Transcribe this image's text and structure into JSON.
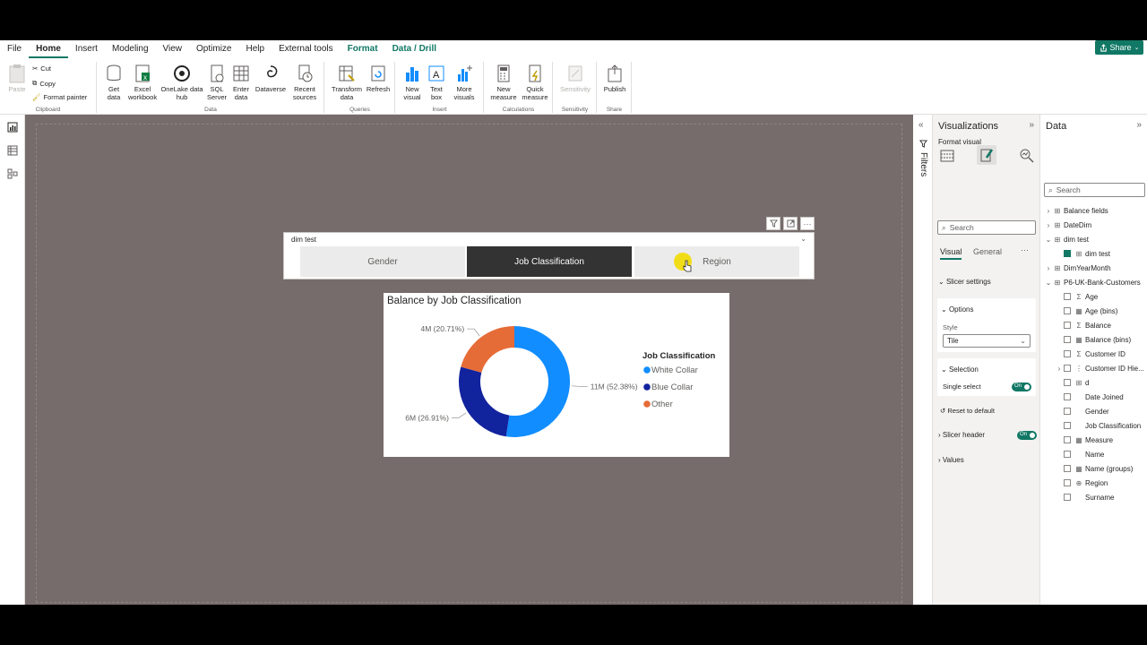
{
  "menu": [
    "File",
    "Home",
    "Insert",
    "Modeling",
    "View",
    "Optimize",
    "Help",
    "External tools",
    "Format",
    "Data / Drill"
  ],
  "menu_active": "Home",
  "share_label": "Share",
  "ribbon": {
    "clipboard": {
      "paste": "Paste",
      "cut": "Cut",
      "copy": "Copy",
      "format_painter": "Format painter",
      "label": "Clipboard"
    },
    "data": {
      "get_data": "Get\ndata",
      "excel": "Excel\nworkbook",
      "onelake": "OneLake data\nhub",
      "sql": "SQL\nServer",
      "enter": "Enter\ndata",
      "dataverse": "Dataverse",
      "recent": "Recent\nsources",
      "label": "Data"
    },
    "queries": {
      "transform": "Transform\ndata",
      "refresh": "Refresh",
      "label": "Queries"
    },
    "insert": {
      "new_visual": "New\nvisual",
      "text_box": "Text\nbox",
      "more_visuals": "More\nvisuals",
      "label": "Insert"
    },
    "calculations": {
      "new_measure": "New\nmeasure",
      "quick_measure": "Quick\nmeasure",
      "label": "Calculations"
    },
    "sensitivity": {
      "btn": "Sensitivity",
      "label": "Sensitivity"
    },
    "share": {
      "publish": "Publish",
      "label": "Share"
    }
  },
  "slicer": {
    "title": "dim test",
    "tiles": [
      "Gender",
      "Job Classification",
      "Region"
    ],
    "selected_index": 1
  },
  "chart_data": {
    "type": "pie",
    "title": "Balance by Job Classification",
    "legend_title": "Job Classification",
    "legend_position": "right",
    "categories": [
      "White Collar",
      "Blue Collar",
      "Other"
    ],
    "values": [
      52.38,
      26.91,
      20.71
    ],
    "data_labels": [
      "11M (52.38%)",
      "6M (26.91%)",
      "4M (20.71%)"
    ],
    "colors": [
      "#118DFF",
      "#12239E",
      "#E66C37"
    ],
    "donut": true
  },
  "filters_label": "Filters",
  "viz_pane": {
    "title": "Visualizations",
    "subtitle": "Format visual",
    "search_placeholder": "Search",
    "tabs": [
      "Visual",
      "General"
    ],
    "sections": {
      "slicer_settings": "Slicer settings",
      "options": "Options",
      "style_label": "Style",
      "style_value": "Tile",
      "selection": "Selection",
      "single_select": "Single select",
      "single_select_state": "On",
      "reset": "Reset to default",
      "slicer_header": "Slicer header",
      "slicer_header_state": "On",
      "values": "Values"
    }
  },
  "data_pane": {
    "title": "Data",
    "search_placeholder": "Search",
    "fields": [
      {
        "label": "Balance fields",
        "kind": "table",
        "chev": "›",
        "check": false,
        "indent": 0
      },
      {
        "label": "DateDim",
        "kind": "table",
        "chev": "›",
        "check": false,
        "indent": 0
      },
      {
        "label": "dim test",
        "kind": "table",
        "chev": "⌄",
        "check": false,
        "indent": 0
      },
      {
        "label": "dim test",
        "kind": "table",
        "chev": "",
        "check": true,
        "indent": 1
      },
      {
        "label": "DimYearMonth",
        "kind": "table",
        "chev": "›",
        "check": false,
        "indent": 0
      },
      {
        "label": "P6-UK-Bank-Customers",
        "kind": "table",
        "chev": "⌄",
        "check": false,
        "indent": 0
      },
      {
        "label": "Age",
        "kind": "sum",
        "chev": "",
        "check": false,
        "indent": 1
      },
      {
        "label": "Age (bins)",
        "kind": "group",
        "chev": "",
        "check": false,
        "indent": 1
      },
      {
        "label": "Balance",
        "kind": "sum",
        "chev": "",
        "check": false,
        "indent": 1
      },
      {
        "label": "Balance (bins)",
        "kind": "group",
        "chev": "",
        "check": false,
        "indent": 1
      },
      {
        "label": "Customer ID",
        "kind": "sum",
        "chev": "",
        "check": false,
        "indent": 1
      },
      {
        "label": "Customer ID Hie...",
        "kind": "hier",
        "chev": "›",
        "check": false,
        "indent": 1
      },
      {
        "label": "d",
        "kind": "table",
        "chev": "",
        "check": false,
        "indent": 1
      },
      {
        "label": "Date Joined",
        "kind": "none",
        "chev": "",
        "check": false,
        "indent": 1
      },
      {
        "label": "Gender",
        "kind": "none",
        "chev": "",
        "check": false,
        "indent": 1
      },
      {
        "label": "Job Classification",
        "kind": "none",
        "chev": "",
        "check": false,
        "indent": 1
      },
      {
        "label": "Measure",
        "kind": "calc",
        "chev": "",
        "check": false,
        "indent": 1
      },
      {
        "label": "Name",
        "kind": "none",
        "chev": "",
        "check": false,
        "indent": 1
      },
      {
        "label": "Name (groups)",
        "kind": "group",
        "chev": "",
        "check": false,
        "indent": 1
      },
      {
        "label": "Region",
        "kind": "globe",
        "chev": "",
        "check": false,
        "indent": 1
      },
      {
        "label": "Surname",
        "kind": "none",
        "chev": "",
        "check": false,
        "indent": 1
      }
    ]
  }
}
